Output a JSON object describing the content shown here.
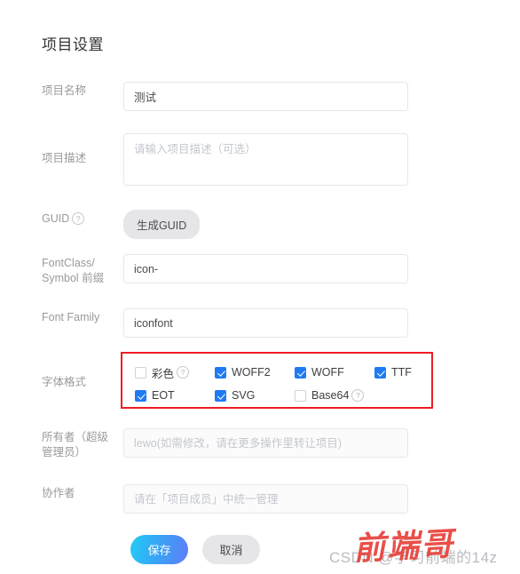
{
  "page": {
    "title": "项目设置"
  },
  "fields": {
    "project_name": {
      "label": "项目名称",
      "value": "测试",
      "placeholder": ""
    },
    "project_desc": {
      "label": "项目描述",
      "value": "",
      "placeholder": "请输入项目描述（可选）"
    },
    "guid": {
      "label": "GUID",
      "help_icon": "question-circle-icon",
      "button_label": "生成GUID"
    },
    "fontclass_prefix": {
      "label": "FontClass/\nSymbol 前缀",
      "label_line1": "FontClass/",
      "label_line2": "Symbol 前缀",
      "value": "icon-",
      "placeholder": ""
    },
    "font_family": {
      "label": "Font Family",
      "value": "iconfont",
      "placeholder": ""
    },
    "font_format": {
      "label": "字体格式",
      "options": [
        {
          "label": "彩色",
          "checked": false,
          "help_icon": "question-circle-icon"
        },
        {
          "label": "WOFF2",
          "checked": true,
          "help_icon": ""
        },
        {
          "label": "WOFF",
          "checked": true,
          "help_icon": ""
        },
        {
          "label": "TTF",
          "checked": true,
          "help_icon": ""
        },
        {
          "label": "EOT",
          "checked": true,
          "help_icon": ""
        },
        {
          "label": "SVG",
          "checked": true,
          "help_icon": ""
        },
        {
          "label": "Base64",
          "checked": false,
          "help_icon": "question-circle-icon"
        }
      ]
    },
    "owner": {
      "label_line1": "所有者（超级",
      "label_line2": "管理员）",
      "value": "",
      "placeholder": "lewo(如需修改，请在更多操作里转让项目)"
    },
    "collaborator": {
      "label": "协作者",
      "value": "",
      "placeholder": "请在「项目成员」中统一管理"
    }
  },
  "actions": {
    "save_label": "保存",
    "cancel_label": "取消"
  },
  "watermark": {
    "csdn_text": "CSDN @学习前端的14z",
    "brand_text": "前端哥"
  },
  "colors": {
    "checkbox_checked": "#1f7bf4",
    "annotation_border": "#ee1c24",
    "save_gradient_start": "#22cdf4",
    "save_gradient_end": "#5f7cf7",
    "watermark_red": "#e8413a"
  }
}
